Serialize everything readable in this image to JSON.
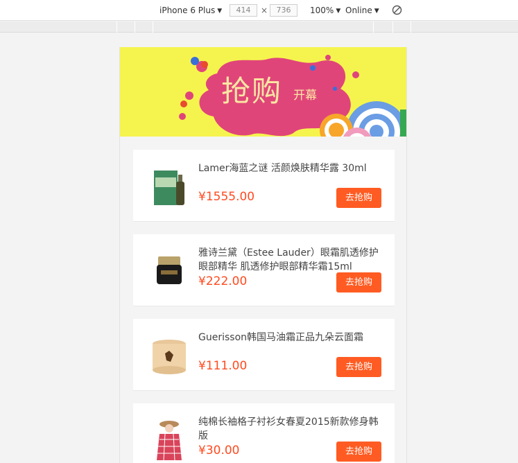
{
  "devtools": {
    "device": "iPhone 6 Plus",
    "width": "414",
    "height": "736",
    "dim_separator": "×",
    "zoom": "100%",
    "network": "Online",
    "caret": "▼"
  },
  "banner": {
    "title": "抢购",
    "subtitle": "开幕"
  },
  "products": [
    {
      "name": "Lamer海蓝之谜 活颜焕肤精华露 30ml",
      "price": "¥1555.00",
      "button": "去抢购"
    },
    {
      "name": "雅诗兰黛（Estee Lauder）眼霜肌透修护眼部精华 肌透修护眼部精华霜15ml",
      "price": "¥222.00",
      "button": "去抢购"
    },
    {
      "name": "Guerisson韩国马油霜正品九朵云面霜",
      "price": "¥111.00",
      "button": "去抢购"
    },
    {
      "name": "纯棉长袖格子衬衫女春夏2015新款修身韩版",
      "price": "¥30.00",
      "button": "去抢购"
    }
  ],
  "colors": {
    "banner_bg": "#f5f44e",
    "splash": "#e0457a",
    "price": "#ff4a1f",
    "button": "#ff5b22"
  }
}
